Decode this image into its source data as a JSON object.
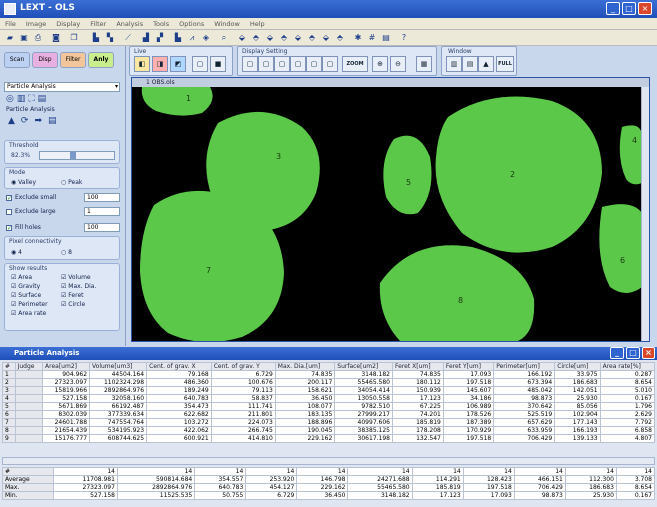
{
  "app": {
    "title": "LEXT - OLS",
    "win_min": "_",
    "win_max": "□",
    "win_close": "×"
  },
  "menu": [
    "File",
    "Image",
    "Display",
    "Filter",
    "Analysis",
    "Tools",
    "Options",
    "Window",
    "Help"
  ],
  "left": {
    "tabs": [
      "Scan",
      "Disp",
      "Filter",
      "Anly"
    ],
    "mode_select": "Particle Analysis",
    "section_title": "Particle Analysis",
    "threshold": {
      "label": "Threshold",
      "value": "82.3%"
    },
    "mode": {
      "label": "Mode",
      "valley": "Valley",
      "peak": "Peak",
      "selected": "valley"
    },
    "exclude_small": {
      "label": "Exclude small",
      "value": "100"
    },
    "exclude_large": {
      "label": "Exclude large",
      "value": "1"
    },
    "fill_holes": {
      "label": "Fill holes",
      "value": "100"
    },
    "pixel_conn": {
      "label": "Pixel connectivity",
      "opt4": "4",
      "opt8": "8",
      "selected": "4"
    },
    "show_results": {
      "label": "Show results",
      "items": [
        "Area",
        "Volume",
        "Gravity",
        "Max. Dia.",
        "Surface",
        "Feret",
        "Perimeter",
        "Circle",
        "Area rate"
      ]
    }
  },
  "view": {
    "live_label": "Live",
    "display_setting_label": "Display Setting",
    "window_label": "Window",
    "zoom_label": "ZOOM",
    "full_label": "FULL",
    "image_title": "1 OBS.ols"
  },
  "particles": {
    "labels": [
      "1",
      "2",
      "3",
      "4",
      "5",
      "6",
      "7",
      "8"
    ]
  },
  "analysis": {
    "title": "Particle Analysis",
    "headers": [
      "#",
      "Judge",
      "Area[um2]",
      "Volume[um3]",
      "Cent. of grav. X",
      "Cent. of grav. Y",
      "Max. Dia.[um]",
      "Surface[um2]",
      "Feret X[um]",
      "Feret Y[um]",
      "Perimeter[um]",
      "Circle[um]",
      "Area rate[%]"
    ],
    "rows": [
      [
        "1",
        "",
        "904.962",
        "44504.164",
        "79.168",
        "6.729",
        "74.835",
        "3148.182",
        "74.835",
        "17.093",
        "166.192",
        "33.975",
        "0.287"
      ],
      [
        "2",
        "",
        "27323.097",
        "1102324.298",
        "486.360",
        "100.676",
        "200.117",
        "55465.580",
        "180.112",
        "197.518",
        "673.394",
        "186.683",
        "8.654"
      ],
      [
        "3",
        "",
        "15819.966",
        "2892864.976",
        "189.249",
        "79.113",
        "158.621",
        "34054.414",
        "150.939",
        "145.607",
        "485.042",
        "142.051",
        "5.010"
      ],
      [
        "4",
        "",
        "527.158",
        "32058.160",
        "640.783",
        "58.837",
        "36.450",
        "13050.558",
        "17.123",
        "34.186",
        "98.873",
        "25.930",
        "0.167"
      ],
      [
        "5",
        "",
        "5671.869",
        "66192.487",
        "354.473",
        "111.741",
        "108.077",
        "9782.510",
        "67.225",
        "106.989",
        "370.642",
        "85.056",
        "1.796"
      ],
      [
        "6",
        "",
        "8302.039",
        "377339.634",
        "622.682",
        "211.801",
        "183.135",
        "27999.217",
        "74.201",
        "178.526",
        "525.519",
        "102.904",
        "2.629"
      ],
      [
        "7",
        "",
        "24601.788",
        "747554.764",
        "103.272",
        "224.073",
        "188.896",
        "40997.606",
        "185.819",
        "187.389",
        "657.629",
        "177.143",
        "7.792"
      ],
      [
        "8",
        "",
        "21654.439",
        "534195.923",
        "422.062",
        "266.745",
        "190.045",
        "38385.125",
        "178.208",
        "170.929",
        "633.959",
        "166.193",
        "6.858"
      ],
      [
        "9",
        "",
        "15176.777",
        "608744.625",
        "600.921",
        "414.810",
        "229.162",
        "30617.198",
        "132.547",
        "197.518",
        "706.429",
        "139.133",
        "4.807"
      ]
    ],
    "summary": [
      [
        "#",
        "14",
        "14",
        "14",
        "14",
        "14",
        "14",
        "14",
        "14",
        "14",
        "14",
        "14"
      ],
      [
        "Average",
        "11708.981",
        "590814.684",
        "354.557",
        "253.920",
        "146.798",
        "24271.688",
        "114.291",
        "128.423",
        "466.151",
        "112.300",
        "3.708"
      ],
      [
        "Max.",
        "27323.097",
        "2892864.976",
        "640.783",
        "454.127",
        "229.162",
        "55465.580",
        "185.819",
        "197.518",
        "706.429",
        "186.683",
        "8.654"
      ],
      [
        "Min.",
        "527.158",
        "11525.535",
        "50.755",
        "6.729",
        "36.450",
        "3148.182",
        "17.123",
        "17.093",
        "98.873",
        "25.930",
        "0.167"
      ]
    ]
  }
}
